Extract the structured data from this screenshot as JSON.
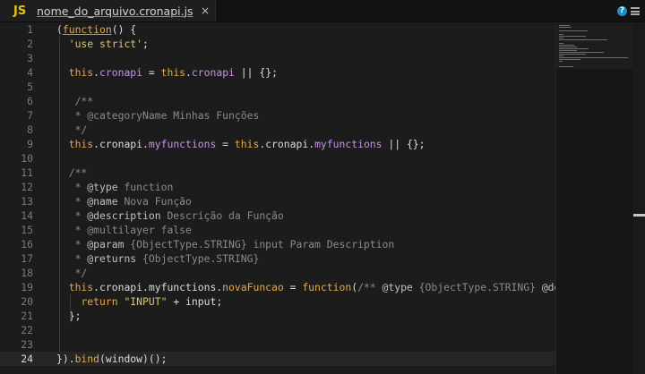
{
  "tab": {
    "icon_text": "JS",
    "title": "nome_do_arquivo.cronapi.js",
    "close": "×"
  },
  "header": {
    "help": "?"
  },
  "icons": {
    "tab": "js-file-icon",
    "close": "close-icon",
    "help": "help-icon",
    "menu": "menu-icon"
  },
  "editor": {
    "active_line": 24,
    "lines": [
      {
        "n": "1",
        "t": [
          [
            "pc",
            "("
          ],
          [
            "fn",
            "function"
          ],
          [
            "pc",
            "() {"
          ]
        ]
      },
      {
        "n": "2",
        "t": [
          [
            "pc",
            "  "
          ],
          [
            "str",
            "'use strict'"
          ],
          [
            "pc",
            ";"
          ]
        ]
      },
      {
        "n": "3",
        "t": []
      },
      {
        "n": "4",
        "t": [
          [
            "pc",
            "  "
          ],
          [
            "kw",
            "this"
          ],
          [
            "pc",
            "."
          ],
          [
            "prop",
            "cronapi"
          ],
          [
            "pc",
            " = "
          ],
          [
            "kw",
            "this"
          ],
          [
            "pc",
            "."
          ],
          [
            "prop",
            "cronapi"
          ],
          [
            "pc",
            " || {};"
          ]
        ]
      },
      {
        "n": "5",
        "t": []
      },
      {
        "n": "6",
        "t": [
          [
            "cm",
            "   /**"
          ]
        ]
      },
      {
        "n": "7",
        "t": [
          [
            "cm",
            "   * @categoryName Minhas Funções"
          ]
        ]
      },
      {
        "n": "8",
        "t": [
          [
            "cm",
            "   */"
          ]
        ]
      },
      {
        "n": "9",
        "t": [
          [
            "pc",
            "  "
          ],
          [
            "kw",
            "this"
          ],
          [
            "pc",
            ".cronapi."
          ],
          [
            "prop",
            "myfunctions"
          ],
          [
            "pc",
            " = "
          ],
          [
            "kw",
            "this"
          ],
          [
            "pc",
            ".cronapi."
          ],
          [
            "prop",
            "myfunctions"
          ],
          [
            "pc",
            " || {};"
          ]
        ]
      },
      {
        "n": "10",
        "t": []
      },
      {
        "n": "11",
        "t": [
          [
            "cm",
            "  /**"
          ]
        ]
      },
      {
        "n": "12",
        "t": [
          [
            "cm",
            "   * "
          ],
          [
            "tag",
            "@type"
          ],
          [
            "cm",
            " function"
          ]
        ]
      },
      {
        "n": "13",
        "t": [
          [
            "cm",
            "   * "
          ],
          [
            "tag",
            "@name"
          ],
          [
            "cm",
            " Nova Função"
          ]
        ]
      },
      {
        "n": "14",
        "t": [
          [
            "cm",
            "   * "
          ],
          [
            "tag",
            "@description"
          ],
          [
            "cm",
            " Descrição da Função"
          ]
        ]
      },
      {
        "n": "15",
        "t": [
          [
            "cm",
            "   * @multilayer false"
          ]
        ]
      },
      {
        "n": "16",
        "t": [
          [
            "cm",
            "   * "
          ],
          [
            "tag",
            "@param"
          ],
          [
            "cm",
            " {ObjectType.STRING} input Param Description"
          ]
        ]
      },
      {
        "n": "17",
        "t": [
          [
            "cm",
            "   * "
          ],
          [
            "tag",
            "@returns"
          ],
          [
            "cm",
            " {ObjectType.STRING}"
          ]
        ]
      },
      {
        "n": "18",
        "t": [
          [
            "cm",
            "   */"
          ]
        ]
      },
      {
        "n": "19",
        "t": [
          [
            "pc",
            "  "
          ],
          [
            "kw",
            "this"
          ],
          [
            "pc",
            ".cronapi.myfunctions."
          ],
          [
            "meth",
            "novaFuncao"
          ],
          [
            "pc",
            " = "
          ],
          [
            "kw",
            "function"
          ],
          [
            "pc",
            "("
          ],
          [
            "cm",
            "/** "
          ],
          [
            "tag",
            "@type"
          ],
          [
            "cm",
            " {ObjectType.STRING} "
          ],
          [
            "tag",
            "@descr"
          ]
        ]
      },
      {
        "n": "20",
        "t": [
          [
            "pc",
            "    "
          ],
          [
            "kw",
            "return"
          ],
          [
            "pc",
            " "
          ],
          [
            "str",
            "\"INPUT\""
          ],
          [
            "pc",
            " + input;"
          ]
        ]
      },
      {
        "n": "21",
        "t": [
          [
            "pc",
            "  };"
          ]
        ]
      },
      {
        "n": "22",
        "t": []
      },
      {
        "n": "23",
        "t": []
      },
      {
        "n": "24",
        "t": [
          [
            "pc",
            "})."
          ],
          [
            "meth",
            "bind"
          ],
          [
            "pc",
            "(window)();"
          ]
        ]
      }
    ]
  }
}
